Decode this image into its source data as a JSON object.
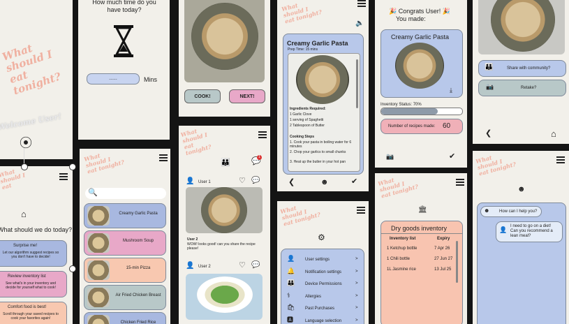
{
  "screen1": {
    "title_lines": [
      "What",
      "should I",
      "eat",
      "tonight?"
    ],
    "welcome": "Welcome User!"
  },
  "screen2": {
    "question_line1": "How much time do you",
    "question_line2": "have today?",
    "input_value": "......",
    "unit": "Mins"
  },
  "screen3": {
    "cook_label": "COOK!",
    "next_label": "NEXT!"
  },
  "screen4": {
    "title": "Creamy Garlic Pasta",
    "prep": "Prep Time: 15 mins",
    "ingredients_heading": "Ingredients Required:",
    "ingredients": [
      "1 Garlic Clove",
      "1 serving of Spaghetti",
      "2 Tablespoon of Butter"
    ],
    "steps_heading": "Cooking Steps",
    "steps": [
      "Cook your pasta in boiling water for 6 minutes",
      "Chop your garlics to small chunks",
      "Heat up the butter in your hot pan"
    ]
  },
  "screen5": {
    "congrats": "🎉 Congrats User! 🎉",
    "made": "You made:",
    "dish": "Creamy Garlic Pasta",
    "inventory_label": "Inventory Status: 70%",
    "inventory_percent": 70,
    "recipes_label": "Number of recipes made:",
    "recipes_count": "60"
  },
  "screen6": {
    "share_label": "Share with community?",
    "retake_label": "Retake?"
  },
  "screen7": {
    "question": "What should we do today?",
    "options": [
      {
        "title": "Surprise me!",
        "desc": "Let our algorithm suggest recipes so you don't have to decide!",
        "color": "#a8b8e0"
      },
      {
        "title": "Review inventory list",
        "desc": "See what's in your inventory and decide for yourself what to cook!",
        "color": "#e8a8c8"
      },
      {
        "title": "Comfort food is best!",
        "desc": "Scroll through your saved recipes to cook your favorites again!",
        "color": "#f8c8b0"
      }
    ]
  },
  "screen8": {
    "recipes": [
      {
        "name": "Creamy Garlic Pasta",
        "color": "#a8b8e0"
      },
      {
        "name": "Mushroom Soup",
        "color": "#e8a8c8"
      },
      {
        "name": "15-min Pizza",
        "color": "#f8c8b0"
      },
      {
        "name": "Air Fried Chicken Breast",
        "color": "#b8c8c8"
      },
      {
        "name": "Chicken Fried Rice",
        "color": "#a8b8e0"
      }
    ]
  },
  "screen9": {
    "title_lines": [
      "What",
      "should I",
      "eat",
      "tonight?"
    ],
    "notification_count": "1",
    "post1_user": "User 1",
    "post2_user": "User 2",
    "post2_comment_user": "User 2",
    "post2_comment": "WOW! looks good! can you share the recipe please!"
  },
  "screen10": {
    "settings": [
      "User settings",
      "Notification settings",
      "Device Permissions",
      "Allergies",
      "Past Purchases",
      "Language selection"
    ]
  },
  "screen11": {
    "title": "Dry goods inventory",
    "col1": "Inventory list",
    "col2": "Expiry",
    "rows": [
      [
        "1 Ketchup bottle",
        "7 Apr 26"
      ],
      [
        "1 Chili bottle",
        "27 Jun 27"
      ],
      [
        "1L Jasmine rice",
        "13 Jul 25"
      ]
    ]
  },
  "screen12": {
    "bot_msg": "How can I help you?",
    "user_msg": "I need to go on a diet! Can you recommend a lean meal?"
  },
  "colors": {
    "blue": "#a8b8e0",
    "pink": "#e8a8c8",
    "peach": "#f8c8b0",
    "slate": "#b8c8c8"
  }
}
